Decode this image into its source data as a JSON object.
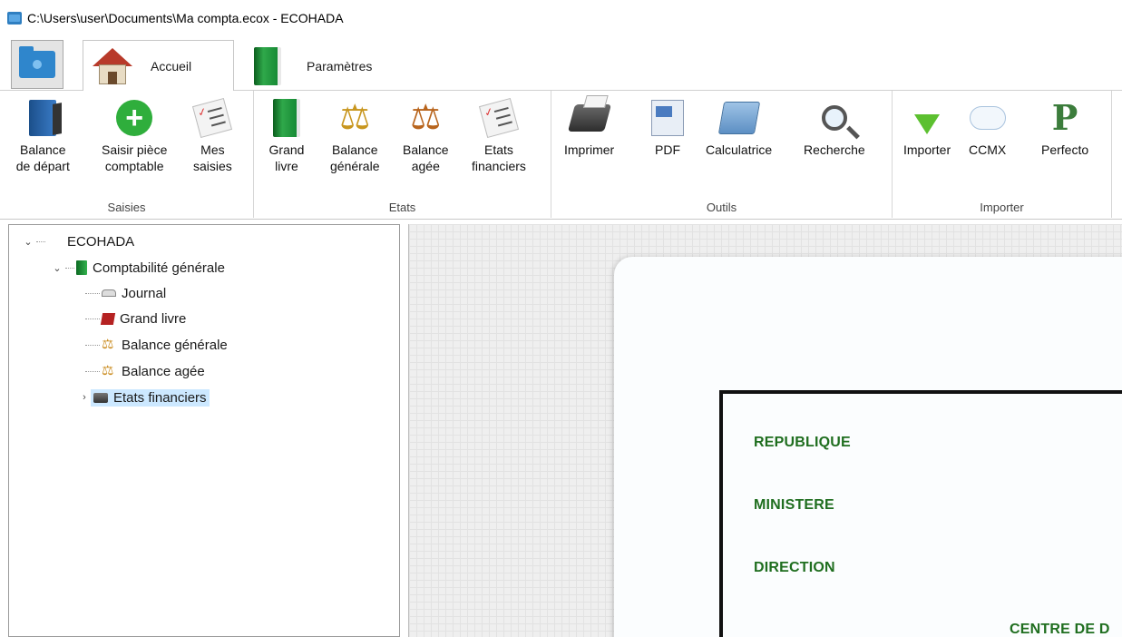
{
  "window": {
    "title": "C:\\Users\\user\\Documents\\Ma compta.ecox - ECOHADA"
  },
  "tabs": {
    "home": "Accueil",
    "settings": "Paramètres"
  },
  "ribbon": {
    "saisies": {
      "label": "Saisies",
      "buttons": [
        {
          "line1": "Balance",
          "line2": "de départ",
          "icon": "opening-balance-icon"
        },
        {
          "line1": "Saisir pièce",
          "line2": "comptable",
          "icon": "add-entry-icon"
        },
        {
          "line1": "Mes",
          "line2": "saisies",
          "icon": "my-entries-icon"
        }
      ]
    },
    "etats": {
      "label": "Etats",
      "buttons": [
        {
          "line1": "Grand",
          "line2": "livre",
          "icon": "general-ledger-icon"
        },
        {
          "line1": "Balance",
          "line2": "générale",
          "icon": "general-balance-icon"
        },
        {
          "line1": "Balance",
          "line2": "agée",
          "icon": "aged-balance-icon"
        },
        {
          "line1": "Etats",
          "line2": "financiers",
          "icon": "financial-statements-icon"
        }
      ]
    },
    "outils": {
      "label": "Outils",
      "buttons": [
        {
          "line1": "Imprimer",
          "icon": "printer-icon"
        },
        {
          "line1": "PDF",
          "icon": "pdf-icon"
        },
        {
          "line1": "Calculatrice",
          "icon": "calculator-icon"
        },
        {
          "line1": "Recherche",
          "icon": "search-icon"
        }
      ]
    },
    "importer": {
      "label": "Importer",
      "buttons": [
        {
          "line1": "Importer",
          "icon": "import-icon"
        },
        {
          "line1": "CCMX",
          "icon": "ccmx-icon"
        },
        {
          "line1": "Perfecto",
          "icon": "perfecto-icon"
        }
      ]
    }
  },
  "tree": {
    "root": "ECOHADA",
    "group": "Comptabilité générale",
    "items": [
      "Journal",
      "Grand livre",
      "Balance générale",
      "Balance agée",
      "Etats financiers"
    ]
  },
  "document": {
    "lines": [
      "REPUBLIQUE",
      "MINISTERE",
      "DIRECTION",
      "CENTRE DE D"
    ]
  }
}
